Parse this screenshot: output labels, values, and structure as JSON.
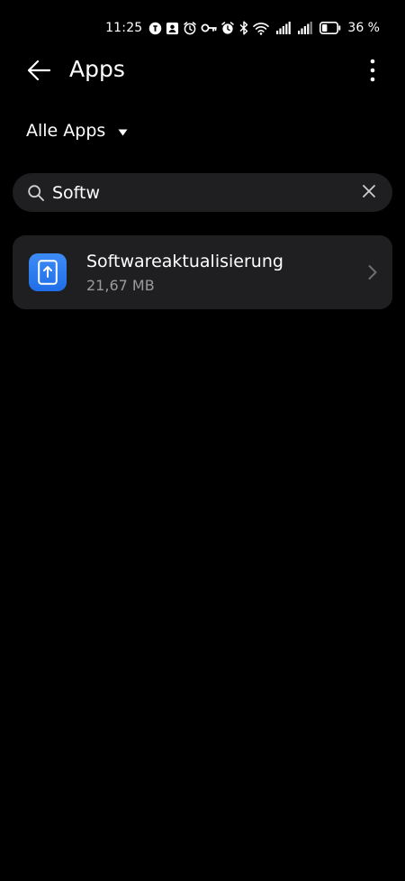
{
  "status_bar": {
    "time": "11:25",
    "battery_percent": "36 %",
    "battery_level": 0.36,
    "icons": [
      "notification-badge-icon",
      "contact-card-icon",
      "alarm-icon",
      "key-icon",
      "alarm-off-icon",
      "bluetooth-icon",
      "wifi-icon",
      "signal-icon",
      "signal-icon",
      "battery-icon"
    ]
  },
  "app_bar": {
    "title": "Apps",
    "back_icon": "arrow-left-icon",
    "more_icon": "more-vertical-icon"
  },
  "filter": {
    "label": "Alle Apps",
    "icon": "caret-down-icon"
  },
  "search": {
    "value": "Softw",
    "placeholder": "",
    "icon": "search-icon",
    "clear_icon": "close-icon"
  },
  "apps": [
    {
      "name": "Softwareaktualisierung",
      "size": "21,67 MB",
      "icon": "software-update-icon"
    }
  ],
  "colors": {
    "background": "#000000",
    "surface": "#1f1f21",
    "text_primary": "#ffffff",
    "text_secondary": "#9a9a9c",
    "accent": "#2a7cf0"
  }
}
